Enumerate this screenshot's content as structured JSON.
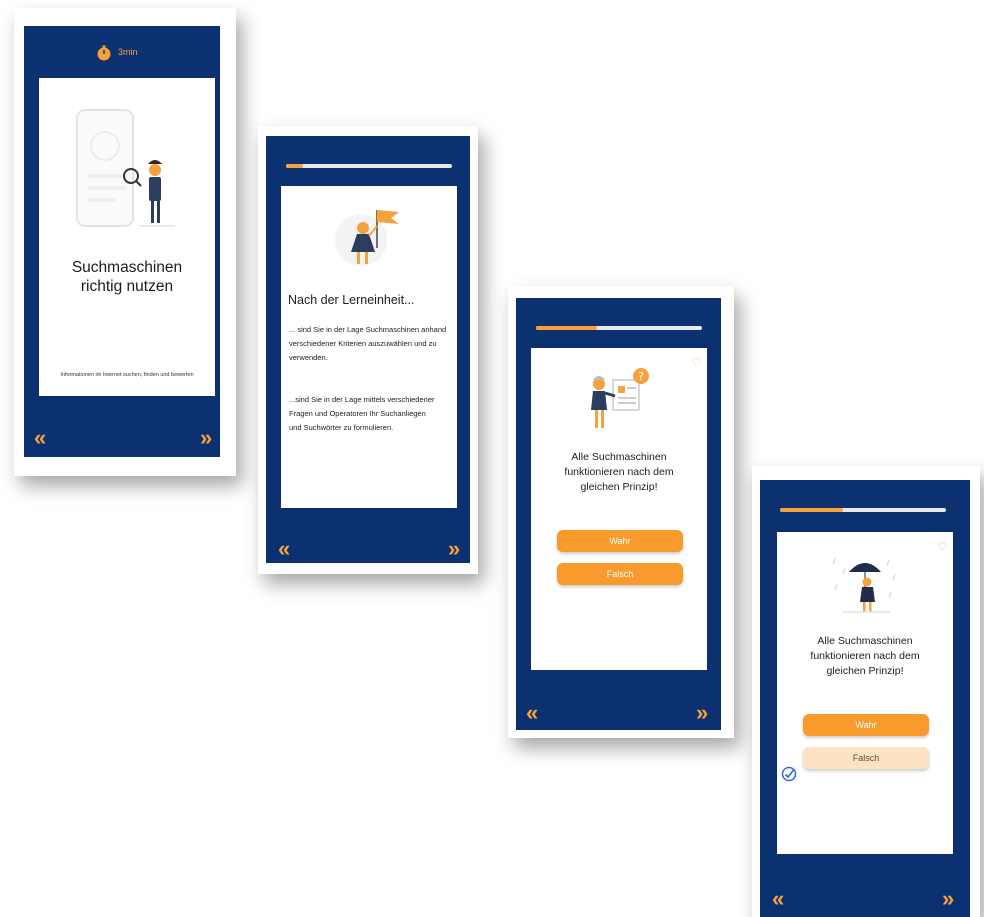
{
  "screen1": {
    "duration": "3min",
    "title_line1": "Suchmaschinen",
    "title_line2": "richtig nutzen",
    "subtitle": "Informationen im Internet suchen, finden und bewerten",
    "nav_prev": "«",
    "nav_next": "»"
  },
  "screen2": {
    "progress": 0.1,
    "heading": "Nach der Lerneinheit...",
    "paragraph1": "... sind Sie in der Lage Suchmaschinen anhand verschiedener Kriterien auszuwählen und zu verwenden.",
    "paragraph2": "...sind Sie in der Lage mittels verschiedener Fragen und Operatoren Ihr Suchanliegen und Suchwörter zu formulieren.",
    "nav_prev": "«",
    "nav_next": "»"
  },
  "screen3": {
    "progress": 0.37,
    "question_line1": "Alle Suchmaschinen",
    "question_line2": "funktionieren nach dem",
    "question_line3": "gleichen Prinzip!",
    "answer_true": "Wahr",
    "answer_false": "Falsch",
    "nav_prev": "«",
    "nav_next": "»"
  },
  "screen4": {
    "progress": 0.38,
    "question_line1": "Alle Suchmaschinen",
    "question_line2": "funktionieren nach dem",
    "question_line3": "gleichen Prinzip!",
    "answer_true": "Wahr",
    "answer_false": "Falsch",
    "nav_prev": "«",
    "nav_next": "»"
  },
  "colors": {
    "screen_bg": "#0c3170",
    "accent": "#f7a13c",
    "selected_pale": "#fde2c4"
  }
}
